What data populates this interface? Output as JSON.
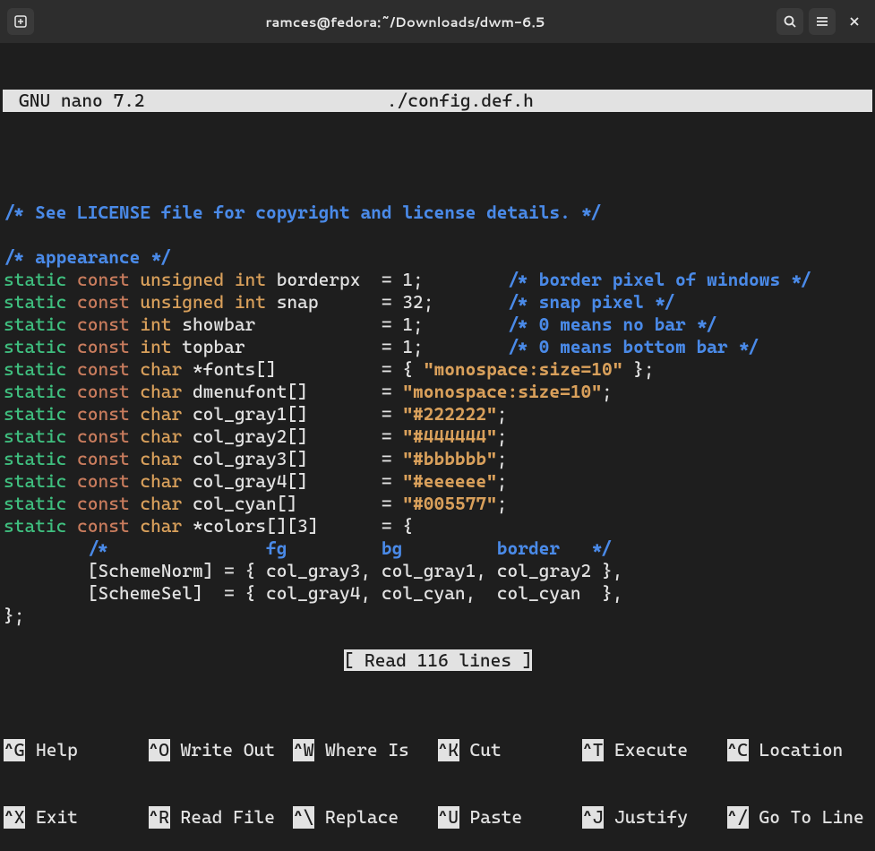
{
  "titlebar": {
    "title": "ramces@fedora:~/Downloads/dwm-6.5"
  },
  "nano": {
    "app": "GNU nano 7.2",
    "file": "./config.def.h",
    "status": "[ Read 116 lines ]"
  },
  "code": {
    "l1_comment": "/* See LICENSE file for copyright and license details. */",
    "l2_comment": "/* appearance */",
    "l3": {
      "kw1": "static",
      "kw2": "const",
      "type": "unsigned int",
      "rest": " borderpx  = 1;        ",
      "comment": "/* border pixel of windows */"
    },
    "l4": {
      "kw1": "static",
      "kw2": "const",
      "type": "unsigned int",
      "rest": " snap      = 32;       ",
      "comment": "/* snap pixel */"
    },
    "l5": {
      "kw1": "static",
      "kw2": "const",
      "type": "int",
      "rest": " showbar            = 1;        ",
      "comment": "/* 0 means no bar */"
    },
    "l6": {
      "kw1": "static",
      "kw2": "const",
      "type": "int",
      "rest": " topbar             = 1;        ",
      "comment": "/* 0 means bottom bar */"
    },
    "l7": {
      "kw1": "static",
      "kw2": "const",
      "type": "char",
      "rest1": " *fonts[]          = { ",
      "str": "\"monospace:size=10\"",
      "rest2": " };"
    },
    "l8": {
      "kw1": "static",
      "kw2": "const",
      "type": "char",
      "rest1": " dmenufont[]       = ",
      "str": "\"monospace:size=10\"",
      "rest2": ";"
    },
    "l9": {
      "kw1": "static",
      "kw2": "const",
      "type": "char",
      "rest1": " col_gray1[]       = ",
      "str": "\"#222222\"",
      "rest2": ";"
    },
    "l10": {
      "kw1": "static",
      "kw2": "const",
      "type": "char",
      "rest1": " col_gray2[]       = ",
      "str": "\"#444444\"",
      "rest2": ";"
    },
    "l11": {
      "kw1": "static",
      "kw2": "const",
      "type": "char",
      "rest1": " col_gray3[]       = ",
      "str": "\"#bbbbbb\"",
      "rest2": ";"
    },
    "l12": {
      "kw1": "static",
      "kw2": "const",
      "type": "char",
      "rest1": " col_gray4[]       = ",
      "str": "\"#eeeeee\"",
      "rest2": ";"
    },
    "l13": {
      "kw1": "static",
      "kw2": "const",
      "type": "char",
      "rest1": " col_cyan[]        = ",
      "str": "\"#005577\"",
      "rest2": ";"
    },
    "l14": {
      "kw1": "static",
      "kw2": "const",
      "type": "char",
      "rest": " *colors[][3]      = {"
    },
    "l15_comment": "        /*               fg         bg         border   */",
    "l16": "        [SchemeNorm] = { col_gray3, col_gray1, col_gray2 },",
    "l17": "        [SchemeSel]  = { col_gray4, col_cyan,  col_cyan  },",
    "l18": "};"
  },
  "shortcuts": {
    "r1": [
      {
        "key": "^G",
        "label": "Help"
      },
      {
        "key": "^O",
        "label": "Write Out"
      },
      {
        "key": "^W",
        "label": "Where Is"
      },
      {
        "key": "^K",
        "label": "Cut"
      },
      {
        "key": "^T",
        "label": "Execute"
      },
      {
        "key": "^C",
        "label": "Location"
      }
    ],
    "r2": [
      {
        "key": "^X",
        "label": "Exit"
      },
      {
        "key": "^R",
        "label": "Read File"
      },
      {
        "key": "^\\",
        "label": "Replace"
      },
      {
        "key": "^U",
        "label": "Paste"
      },
      {
        "key": "^J",
        "label": "Justify"
      },
      {
        "key": "^/",
        "label": "Go To Line"
      }
    ]
  }
}
